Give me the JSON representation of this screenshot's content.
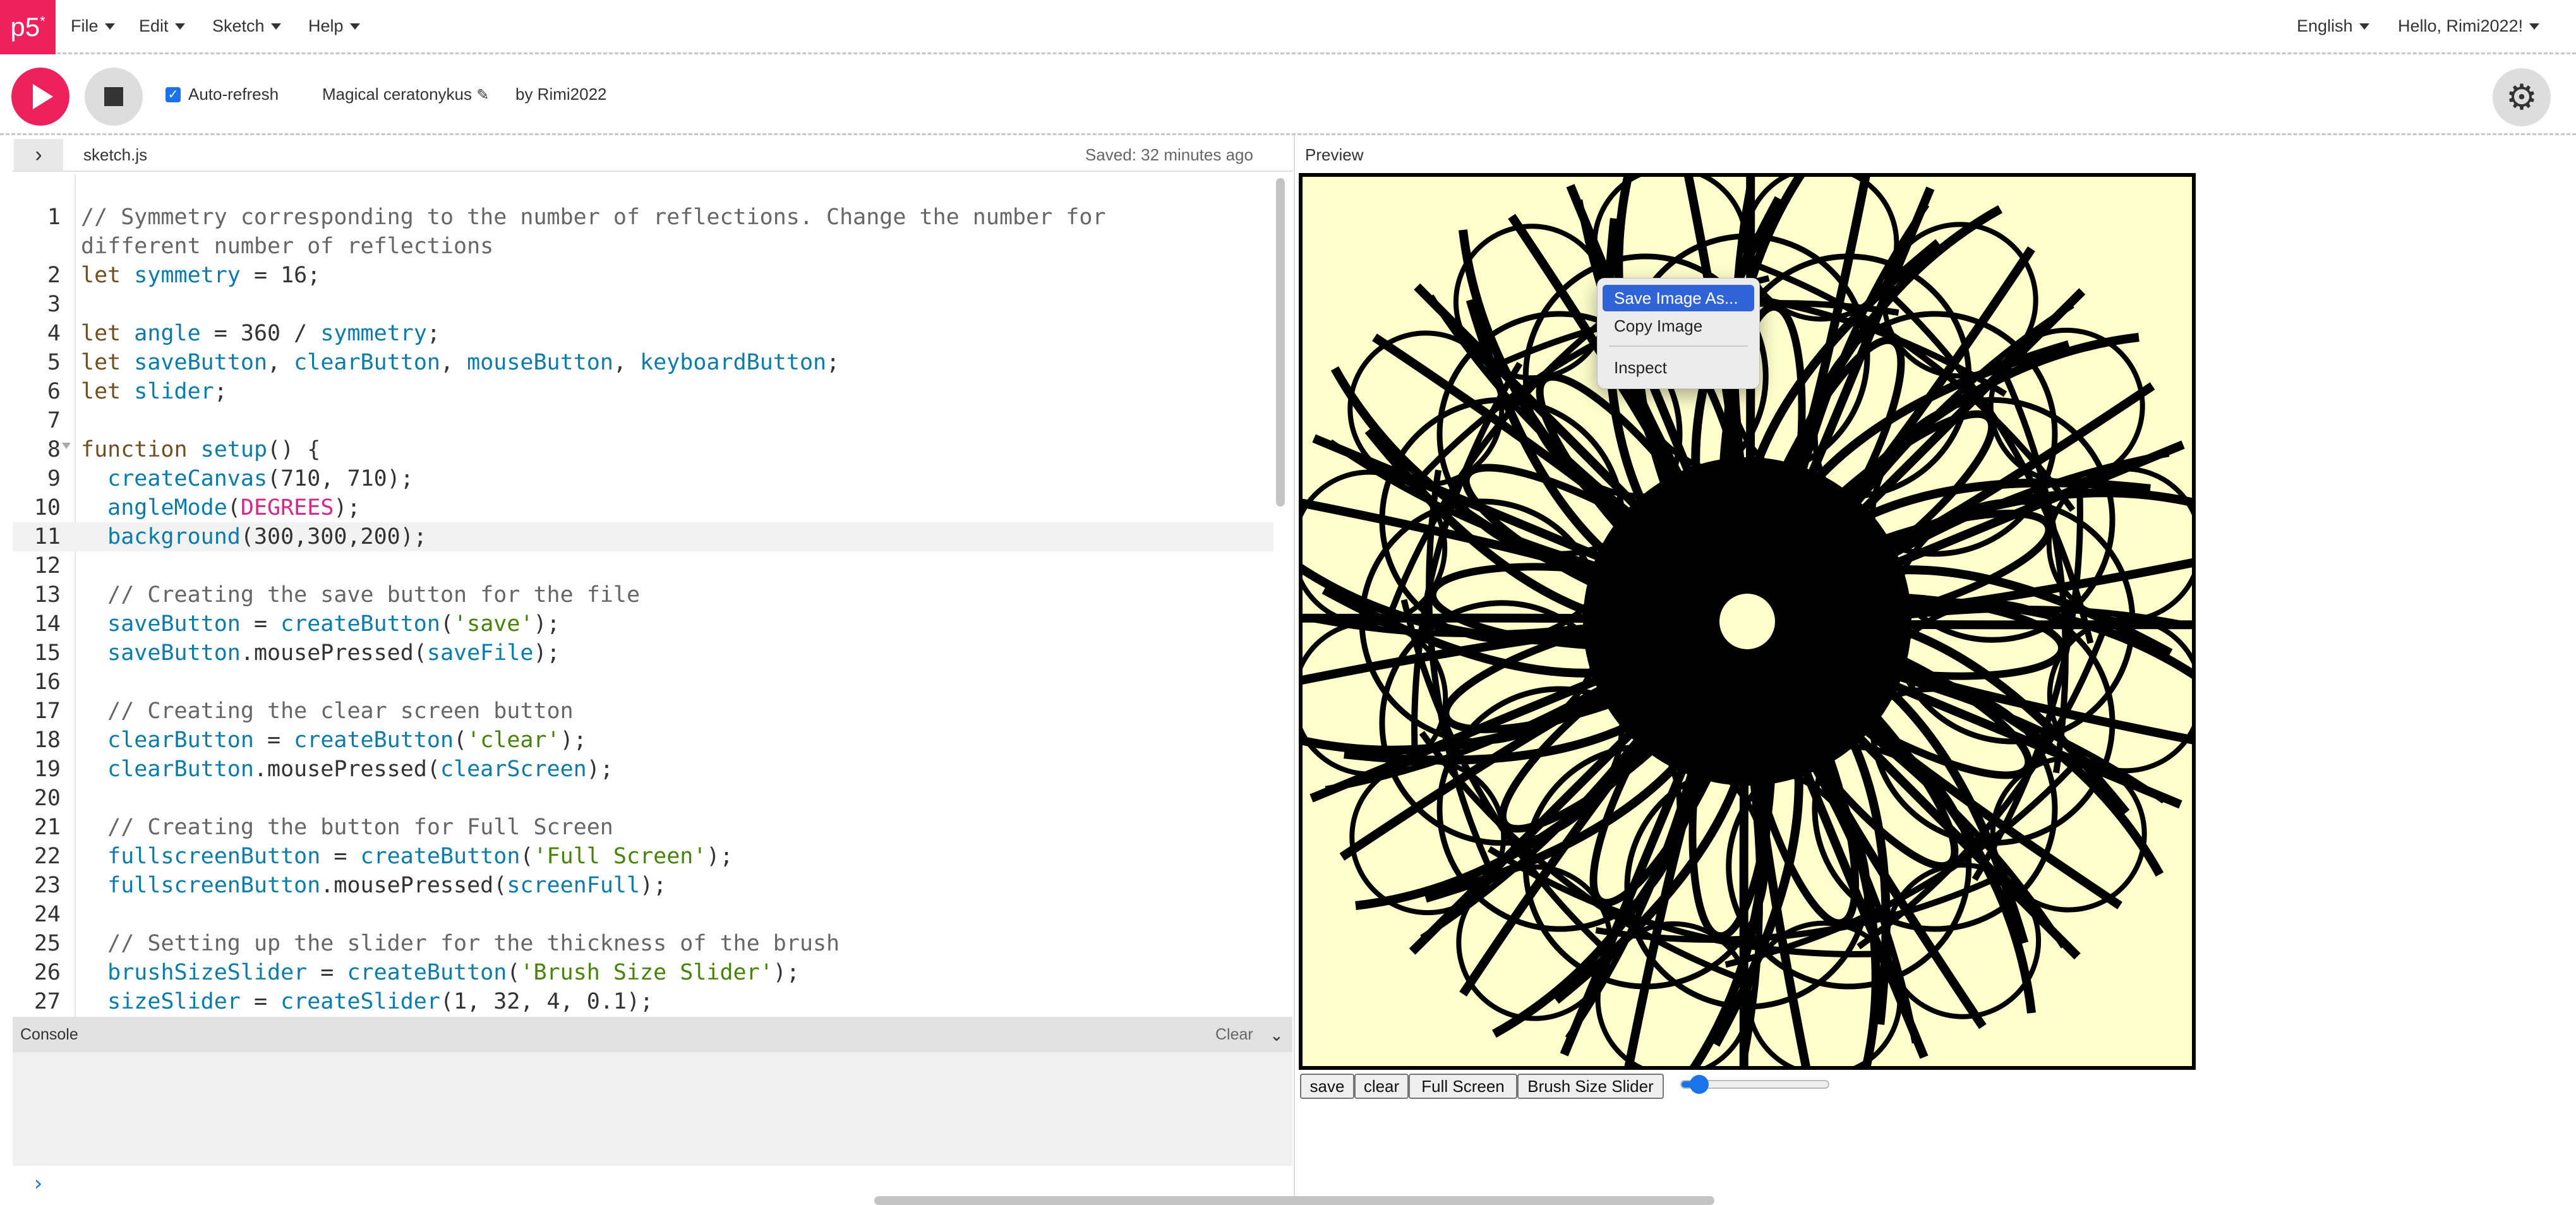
{
  "nav": {
    "logo": "p5",
    "logo_mark": "*",
    "menus": [
      "File",
      "Edit",
      "Sketch",
      "Help"
    ],
    "language": "English",
    "greeting": "Hello, Rimi2022!"
  },
  "toolbar": {
    "auto_refresh_label": "Auto-refresh",
    "auto_refresh_checked": true,
    "sketch_name": "Magical ceratonykus",
    "by_user": "by Rimi2022"
  },
  "editor": {
    "filename": "sketch.js",
    "saved_status": "Saved: 32 minutes ago",
    "active_line": 11,
    "lines": [
      {
        "n": "1",
        "text": "// Symmetry corresponding to the number of reflections. Change the number for"
      },
      {
        "n": "",
        "text": "different number of reflections"
      },
      {
        "n": "2",
        "text": "let symmetry = 16;"
      },
      {
        "n": "3",
        "text": ""
      },
      {
        "n": "4",
        "text": "let angle = 360 / symmetry;"
      },
      {
        "n": "5",
        "text": "let saveButton, clearButton, mouseButton, keyboardButton;"
      },
      {
        "n": "6",
        "text": "let slider;"
      },
      {
        "n": "7",
        "text": ""
      },
      {
        "n": "8",
        "text": "function setup() {"
      },
      {
        "n": "9",
        "text": "  createCanvas(710, 710);"
      },
      {
        "n": "10",
        "text": "  angleMode(DEGREES);"
      },
      {
        "n": "11",
        "text": "  background(300,300,200);"
      },
      {
        "n": "12",
        "text": ""
      },
      {
        "n": "13",
        "text": "  // Creating the save button for the file"
      },
      {
        "n": "14",
        "text": "  saveButton = createButton('save');"
      },
      {
        "n": "15",
        "text": "  saveButton.mousePressed(saveFile);"
      },
      {
        "n": "16",
        "text": ""
      },
      {
        "n": "17",
        "text": "  // Creating the clear screen button"
      },
      {
        "n": "18",
        "text": "  clearButton = createButton('clear');"
      },
      {
        "n": "19",
        "text": "  clearButton.mousePressed(clearScreen);"
      },
      {
        "n": "20",
        "text": ""
      },
      {
        "n": "21",
        "text": "  // Creating the button for Full Screen"
      },
      {
        "n": "22",
        "text": "  fullscreenButton = createButton('Full Screen');"
      },
      {
        "n": "23",
        "text": "  fullscreenButton.mousePressed(screenFull);"
      },
      {
        "n": "24",
        "text": ""
      },
      {
        "n": "25",
        "text": "  // Setting up the slider for the thickness of the brush"
      },
      {
        "n": "26",
        "text": "  brushSizeSlider = createButton('Brush Size Slider');"
      },
      {
        "n": "27",
        "text": "  sizeSlider = createSlider(1, 32, 4, 0.1);"
      }
    ]
  },
  "console": {
    "title": "Console",
    "clear_label": "Clear"
  },
  "preview": {
    "label": "Preview",
    "canvas_bg": "#ffffcc",
    "context_menu": [
      "Save Image As...",
      "Copy Image",
      "Inspect"
    ],
    "buttons": [
      "save",
      "clear",
      "Full Screen",
      "Brush Size Slider"
    ],
    "slider_value": 4,
    "slider_min": 1,
    "slider_max": 32
  },
  "colors": {
    "accent": "#ed225d",
    "link_blue": "#1a73e8"
  }
}
